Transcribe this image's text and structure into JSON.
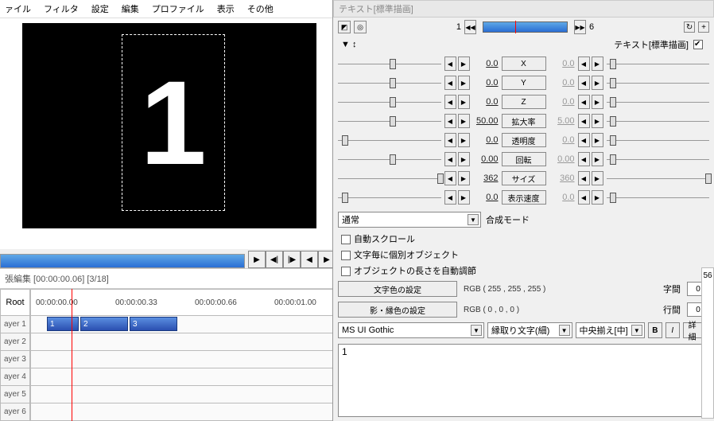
{
  "menu": [
    "ァイル",
    "フィルタ",
    "設定",
    "編集",
    "プロファイル",
    "表示",
    "その他"
  ],
  "preview_number": "1",
  "timeline_title": "張編集 [00:00:00.06] [3/18]",
  "root_label": "Root",
  "times": [
    "00:00:00.00",
    "00:00:00.33",
    "00:00:00.66",
    "00:00:01.00"
  ],
  "layers": [
    "ayer 1",
    "ayer 2",
    "ayer 3",
    "ayer 4",
    "ayer 5",
    "ayer 6"
  ],
  "clips": [
    "1",
    "2",
    "3"
  ],
  "panel_title": "テキスト[標準描画]",
  "frame_start": "1",
  "frame_end": "6",
  "header_right": "テキスト[標準描画]",
  "props": [
    {
      "label": "X",
      "l": "0.0",
      "r": "0.0",
      "lt": 50,
      "rt": 5
    },
    {
      "label": "Y",
      "l": "0.0",
      "r": "0.0",
      "lt": 50,
      "rt": 5
    },
    {
      "label": "Z",
      "l": "0.0",
      "r": "0.0",
      "lt": 50,
      "rt": 5
    },
    {
      "label": "拡大率",
      "l": "50.00",
      "r": "5.00",
      "lt": 50,
      "rt": 5
    },
    {
      "label": "透明度",
      "l": "0.0",
      "r": "0.0",
      "lt": 5,
      "rt": 5
    },
    {
      "label": "回転",
      "l": "0.00",
      "r": "0.00",
      "lt": 50,
      "rt": 5
    },
    {
      "label": "サイズ",
      "l": "362",
      "r": "360",
      "lt": 95,
      "rt": 95
    },
    {
      "label": "表示速度",
      "l": "0.0",
      "r": "0.0",
      "lt": 5,
      "rt": 5
    }
  ],
  "blend_label": "通常",
  "blend_title": "合成モード",
  "chk1": "自動スクロール",
  "chk2": "文字毎に個別オブジェクト",
  "chk3": "オブジェクトの長さを自動調節",
  "color_btn": "文字色の設定",
  "shadow_btn": "影・縁色の設定",
  "rgb1": "RGB ( 255 , 255 , 255 )",
  "rgb2": "RGB ( 0 , 0 , 0 )",
  "spacing_label": "字間",
  "spacing_val": "0",
  "line_label": "行間",
  "line_val": "0",
  "font": "MS UI Gothic",
  "outline": "縁取り文字(細)",
  "align": "中央揃え[中]",
  "b": "B",
  "i": "I",
  "detail": "詳細",
  "text_content": "1",
  "side_val": "56"
}
